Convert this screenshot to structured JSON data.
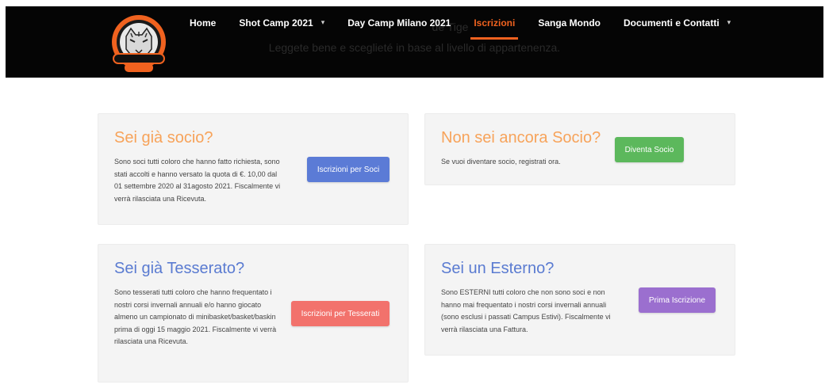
{
  "header": {
    "bg_line1": "de    Tige",
    "bg_line2": "Leggete bene e sceglieté in base al livello di appartenenza.",
    "logo": {
      "top_text": "SANGA'S TIGERS",
      "bottom_text": "MILANO"
    },
    "nav": [
      {
        "label": "Home",
        "has_caret": false
      },
      {
        "label": "Shot Camp 2021",
        "has_caret": true
      },
      {
        "label": "Day Camp Milano 2021",
        "has_caret": false
      },
      {
        "label": "Iscrizioni",
        "has_caret": false,
        "active": true
      },
      {
        "label": "Sanga Mondo",
        "has_caret": false
      },
      {
        "label": "Documenti e Contatti",
        "has_caret": true
      }
    ],
    "caret_glyph": "▾"
  },
  "cards": {
    "socio": {
      "title": "Sei già socio?",
      "text": "Sono soci tutti coloro che hanno fatto richiesta, sono stati accolti e hanno versato la quota di €. 10,00 dal 01 settembre 2020 al 31agosto 2021. Fiscalmente vi verrà rilasciata una Ricevuta.",
      "button": "Iscrizioni per Soci",
      "button_color": "#5b7bd6"
    },
    "non_socio": {
      "title": "Non sei ancora Socio?",
      "text": "Se vuoi diventare socio, registrati ora.",
      "button": "Diventa Socio",
      "button_color": "#5cb85c"
    },
    "tesserato": {
      "title": "Sei già Tesserato?",
      "text": "Sono tesserati tutti coloro che hanno frequentato i nostri corsi invernali annuali e/o hanno giocato almeno un campionato di minibasket/basket/baskin prima di oggi 15 maggio 2021.  Fiscalmente vi verrà rilasciata una Ricevuta.",
      "button": "Iscrizioni per Tesserati",
      "button_color": "#f2726c"
    },
    "esterno": {
      "title": "Sei un Esterno?",
      "text": "Sono ESTERNI tutti coloro che non sono soci e non hanno mai frequentato i nostri corsi invernali annuali (sono esclusi i passati Campus Estivi). Fiscalmente vi verrà rilasciata una Fattura.",
      "button": "Prima Iscrizione",
      "button_color": "#9b6fcf"
    }
  },
  "colors": {
    "accent": "#f0621f",
    "title_orange": "#f7a35a",
    "title_blue": "#5a7bd1"
  }
}
